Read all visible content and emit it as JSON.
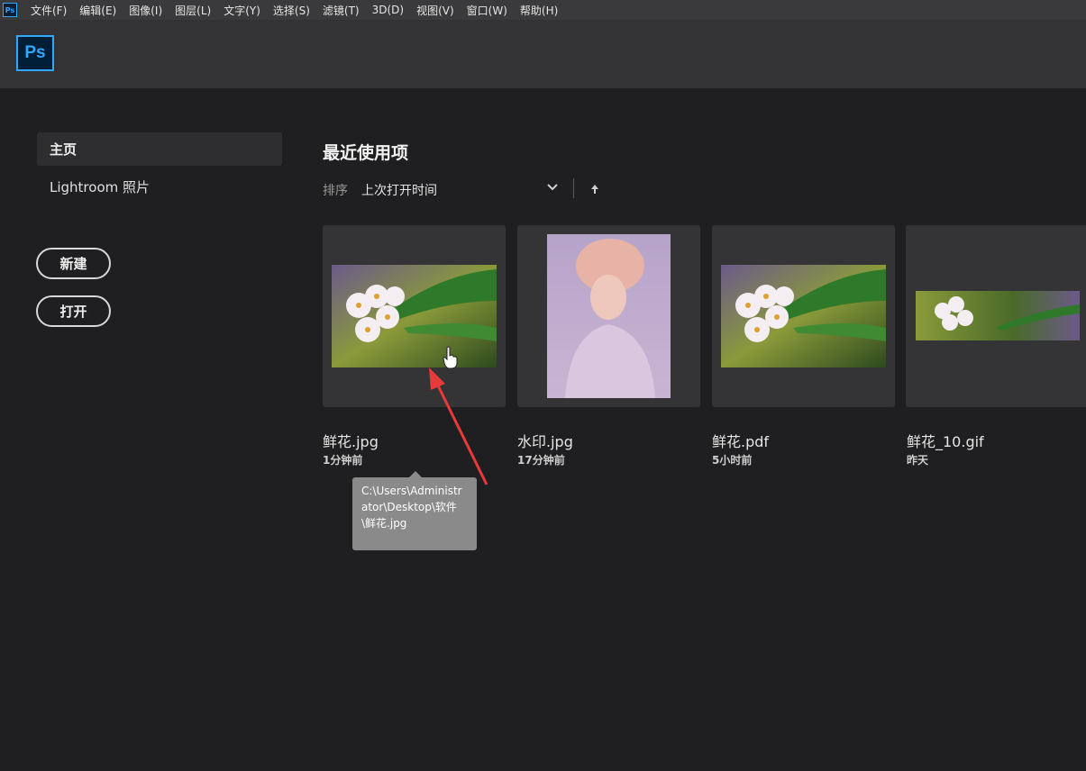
{
  "app": {
    "logo_text": "Ps"
  },
  "menubar": {
    "items": [
      "文件(F)",
      "编辑(E)",
      "图像(I)",
      "图层(L)",
      "文字(Y)",
      "选择(S)",
      "滤镜(T)",
      "3D(D)",
      "视图(V)",
      "窗口(W)",
      "帮助(H)"
    ]
  },
  "sidebar": {
    "home_label": "主页",
    "lightroom_label": "Lightroom 照片",
    "new_button": "新建",
    "open_button": "打开"
  },
  "main": {
    "section_title": "最近使用项",
    "sort_label": "排序",
    "sort_value": "上次打开时间",
    "files": [
      {
        "name": "鲜花.jpg",
        "time": "1分钟前"
      },
      {
        "name": "水印.jpg",
        "time": "17分钟前"
      },
      {
        "name": "鲜花.pdf",
        "time": "5小时前"
      },
      {
        "name": "鲜花_10.gif",
        "time": "昨天"
      }
    ]
  },
  "tooltip": {
    "path": "C:\\Users\\Administrator\\Desktop\\软件\\鲜花.jpg"
  },
  "colors": {
    "accent": "#31a8ff",
    "background": "#1f1e20",
    "card": "#343335",
    "annotation_arrow": "#e83a3a"
  }
}
